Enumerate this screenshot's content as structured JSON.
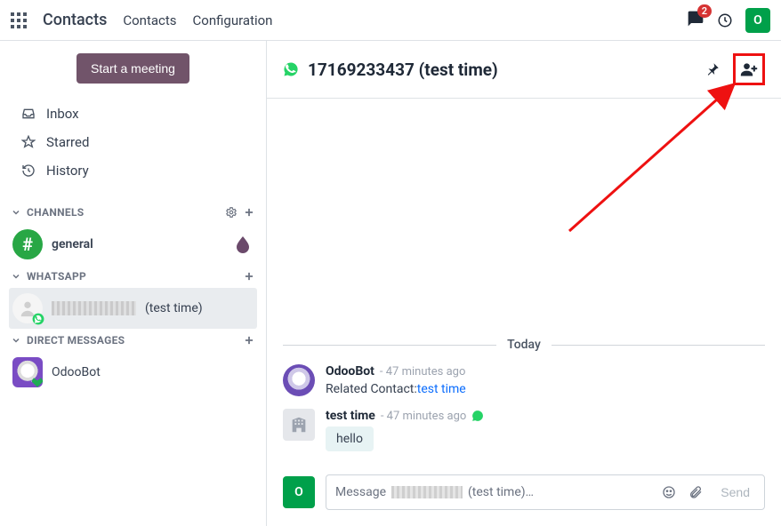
{
  "topbar": {
    "brand": "Contacts",
    "nav": {
      "contacts": "Contacts",
      "configuration": "Configuration"
    },
    "badge_count": "2",
    "user_initial": "O"
  },
  "sidebar": {
    "start_meeting": "Start a meeting",
    "nav": {
      "inbox": "Inbox",
      "starred": "Starred",
      "history": "History"
    },
    "sections": {
      "channels": {
        "label": "CHANNELS",
        "items": [
          {
            "name": "general"
          }
        ]
      },
      "whatsapp": {
        "label": "WHATSAPP",
        "items": [
          {
            "redacted": true,
            "suffix": "(test time)"
          }
        ]
      },
      "direct": {
        "label": "DIRECT MESSAGES",
        "items": [
          {
            "name": "OdooBot"
          }
        ]
      }
    }
  },
  "conversation": {
    "title": "17169233437 (test time)",
    "day_label": "Today",
    "messages": [
      {
        "author": "OdooBot",
        "time": "47 minutes ago",
        "body_prefix": "Related Contact:",
        "body_link": "test time"
      },
      {
        "author": "test time",
        "time": "47 minutes ago",
        "via_whatsapp": true,
        "bubble": "hello"
      }
    ],
    "composer": {
      "placeholder_prefix": "Message ",
      "placeholder_suffix": " (test time)…",
      "send": "Send",
      "avatar_initial": "O"
    }
  }
}
